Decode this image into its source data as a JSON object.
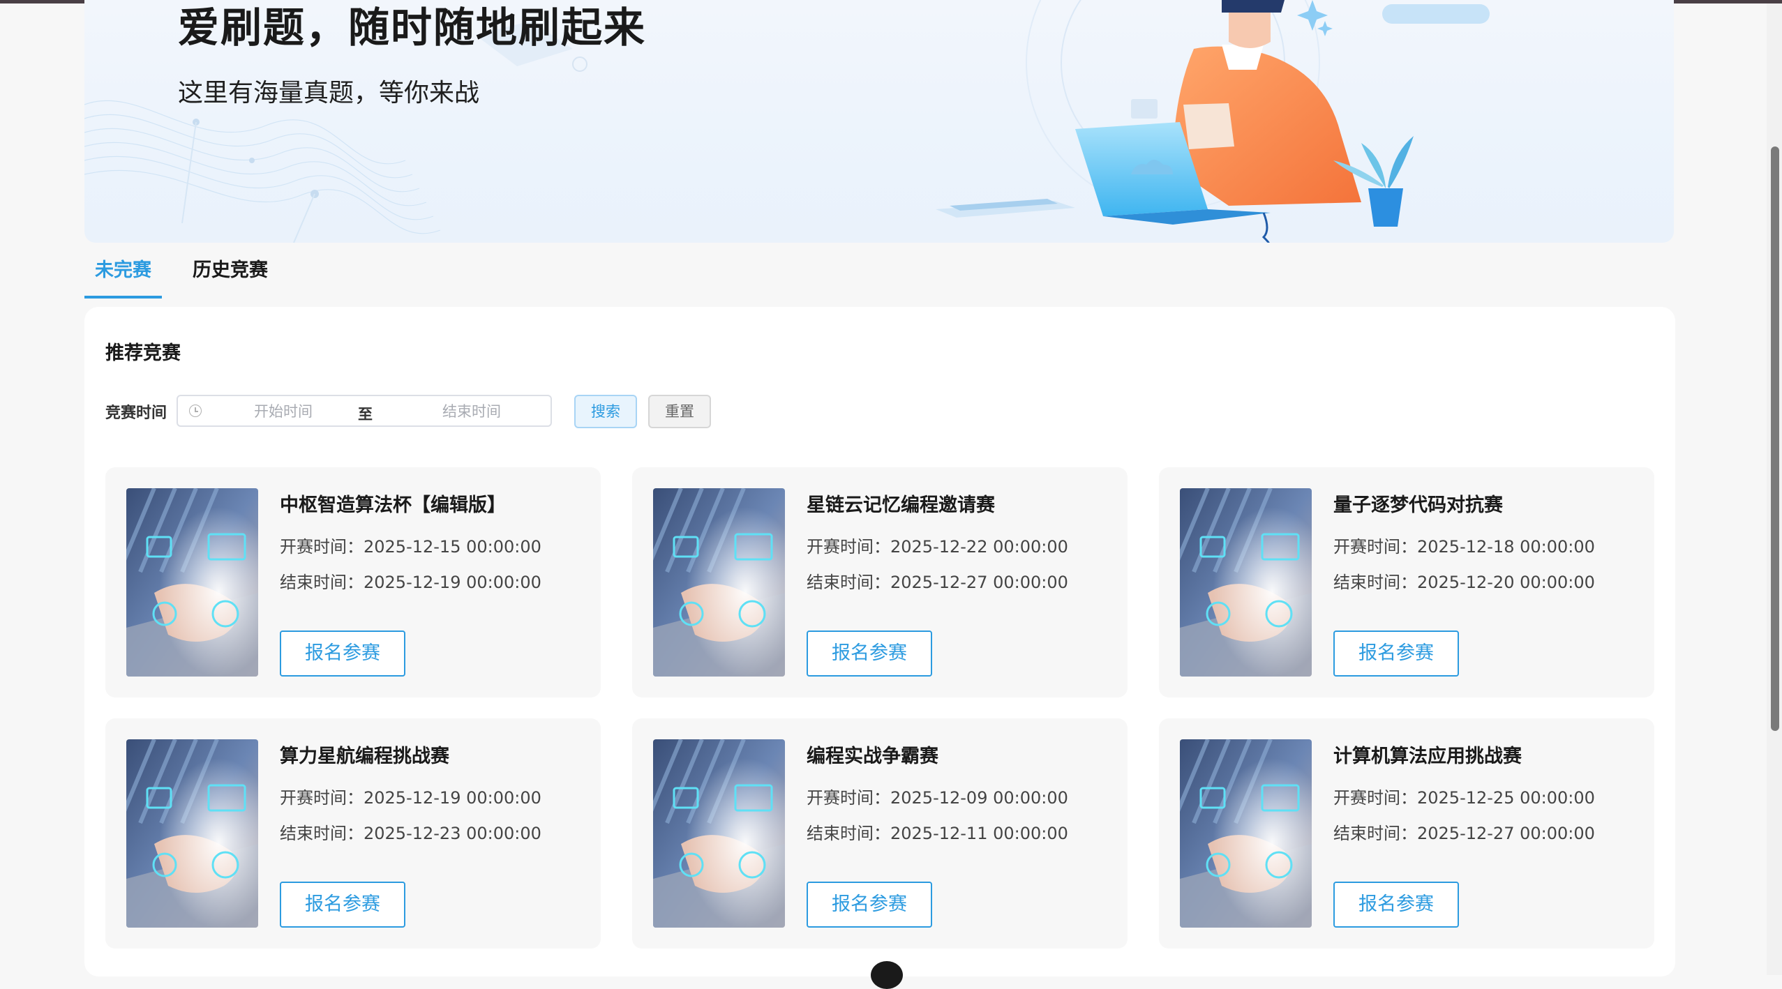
{
  "banner": {
    "title": "爱刷题，随时随地刷起来",
    "subtitle": "这里有海量真题，等你来战"
  },
  "tabs": [
    {
      "label": "未完赛",
      "active": true
    },
    {
      "label": "历史竞赛",
      "active": false
    }
  ],
  "section": {
    "title": "推荐竞赛"
  },
  "filter": {
    "label": "竞赛时间",
    "start_placeholder": "开始时间",
    "separator": "至",
    "end_placeholder": "结束时间",
    "search_label": "搜索",
    "reset_label": "重置"
  },
  "start_prefix": "开赛时间：",
  "end_prefix": "结束时间：",
  "join_label": "报名参赛",
  "competitions": [
    {
      "title": "中枢智造算法杯【编辑版】",
      "start": "2025-12-15 00:00:00",
      "end": "2025-12-19 00:00:00"
    },
    {
      "title": "星链云记忆编程邀请赛",
      "start": "2025-12-22 00:00:00",
      "end": "2025-12-27 00:00:00"
    },
    {
      "title": "量子逐梦代码对抗赛",
      "start": "2025-12-18 00:00:00",
      "end": "2025-12-20 00:00:00"
    },
    {
      "title": "算力星航编程挑战赛",
      "start": "2025-12-19 00:00:00",
      "end": "2025-12-23 00:00:00"
    },
    {
      "title": "编程实战争霸赛",
      "start": "2025-12-09 00:00:00",
      "end": "2025-12-11 00:00:00"
    },
    {
      "title": "计算机算法应用挑战赛",
      "start": "2025-12-25 00:00:00",
      "end": "2025-12-27 00:00:00"
    }
  ],
  "colors": {
    "accent": "#2c9be0",
    "page_bg": "#f7f7f7",
    "card_bg": "#f7f7f7"
  }
}
